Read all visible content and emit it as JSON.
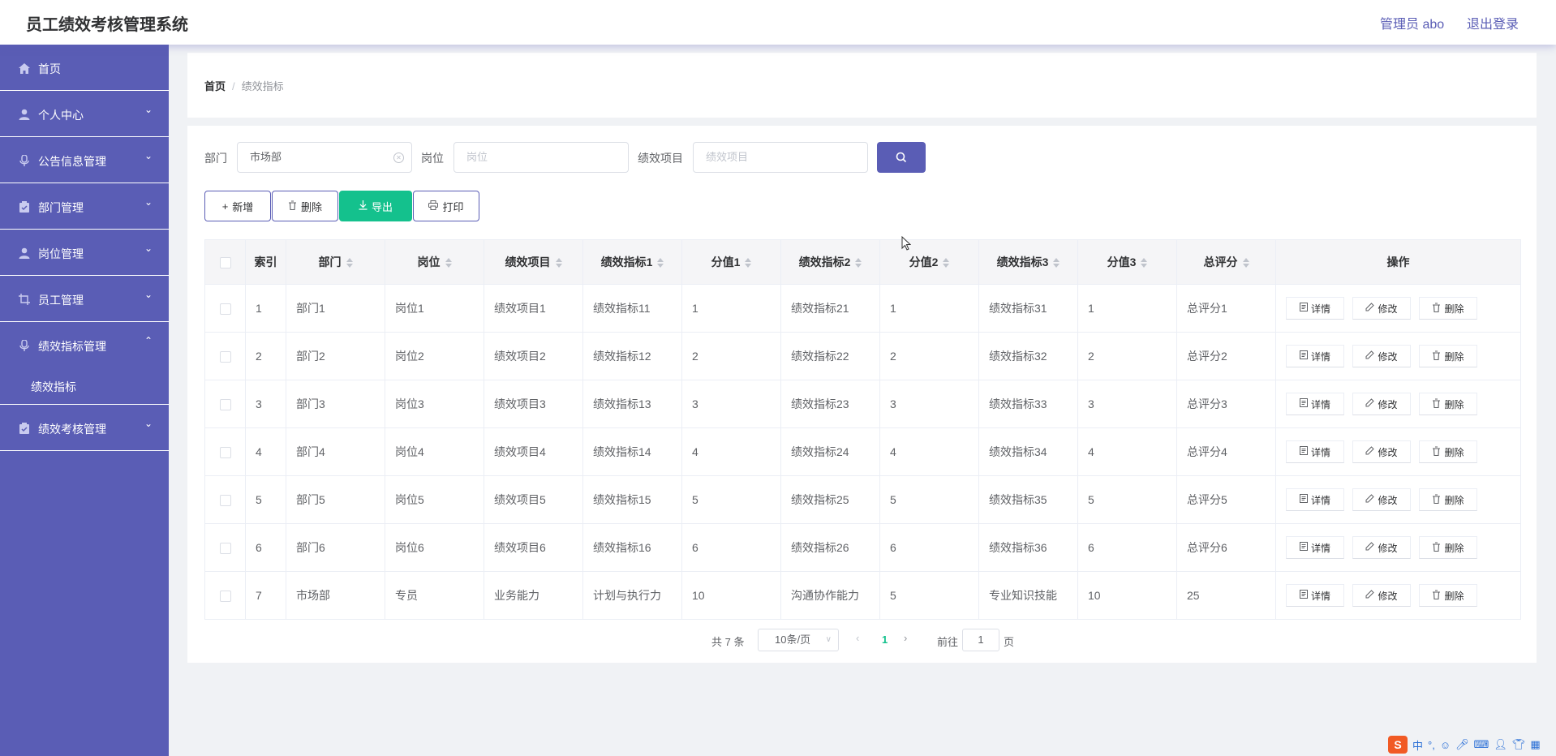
{
  "header": {
    "title": "员工绩效考核管理系统",
    "admin": "管理员 abo",
    "logout": "退出登录"
  },
  "sidebar": {
    "items": [
      {
        "label": "首页",
        "icon": "home-icon"
      },
      {
        "label": "个人中心",
        "icon": "user-icon"
      },
      {
        "label": "公告信息管理",
        "icon": "microphone-icon"
      },
      {
        "label": "部门管理",
        "icon": "clipboard-icon"
      },
      {
        "label": "岗位管理",
        "icon": "user-icon"
      },
      {
        "label": "员工管理",
        "icon": "crop-icon"
      },
      {
        "label": "绩效指标管理",
        "icon": "microphone-icon"
      },
      {
        "label": "绩效考核管理",
        "icon": "clipboard-icon"
      }
    ],
    "sub": {
      "label": "绩效指标"
    }
  },
  "breadcrumb": {
    "home": "首页",
    "sep": "/",
    "current": "绩效指标"
  },
  "search": {
    "dept_label": "部门",
    "dept_value": "市场部",
    "post_label": "岗位",
    "post_placeholder": "岗位",
    "item_label": "绩效项目",
    "item_placeholder": "绩效项目"
  },
  "toolbar": {
    "add": "新增",
    "delete": "删除",
    "export": "导出",
    "print": "打印"
  },
  "table": {
    "headers": [
      "索引",
      "部门",
      "岗位",
      "绩效项目",
      "绩效指标1",
      "分值1",
      "绩效指标2",
      "分值2",
      "绩效指标3",
      "分值3",
      "总评分",
      "操作"
    ],
    "rows": [
      [
        "1",
        "部门1",
        "岗位1",
        "绩效项目1",
        "绩效指标11",
        "1",
        "绩效指标21",
        "1",
        "绩效指标31",
        "1",
        "总评分1"
      ],
      [
        "2",
        "部门2",
        "岗位2",
        "绩效项目2",
        "绩效指标12",
        "2",
        "绩效指标22",
        "2",
        "绩效指标32",
        "2",
        "总评分2"
      ],
      [
        "3",
        "部门3",
        "岗位3",
        "绩效项目3",
        "绩效指标13",
        "3",
        "绩效指标23",
        "3",
        "绩效指标33",
        "3",
        "总评分3"
      ],
      [
        "4",
        "部门4",
        "岗位4",
        "绩效项目4",
        "绩效指标14",
        "4",
        "绩效指标24",
        "4",
        "绩效指标34",
        "4",
        "总评分4"
      ],
      [
        "5",
        "部门5",
        "岗位5",
        "绩效项目5",
        "绩效指标15",
        "5",
        "绩效指标25",
        "5",
        "绩效指标35",
        "5",
        "总评分5"
      ],
      [
        "6",
        "部门6",
        "岗位6",
        "绩效项目6",
        "绩效指标16",
        "6",
        "绩效指标26",
        "6",
        "绩效指标36",
        "6",
        "总评分6"
      ],
      [
        "7",
        "市场部",
        "专员",
        "业务能力",
        "计划与执行力",
        "10",
        "沟通协作能力",
        "5",
        "专业知识技能",
        "10",
        "25"
      ]
    ],
    "actions": {
      "detail": "详情",
      "edit": "修改",
      "delete": "删除"
    }
  },
  "pager": {
    "total": "共 7 条",
    "size": "10条/页",
    "current": "1",
    "goto": "前往",
    "goto_value": "1",
    "page": "页"
  },
  "ime": {
    "logo": "S",
    "lang": "中"
  },
  "colors": {
    "primary": "#5a5db5",
    "export": "#14c18d",
    "active_page": "#14c18d"
  }
}
